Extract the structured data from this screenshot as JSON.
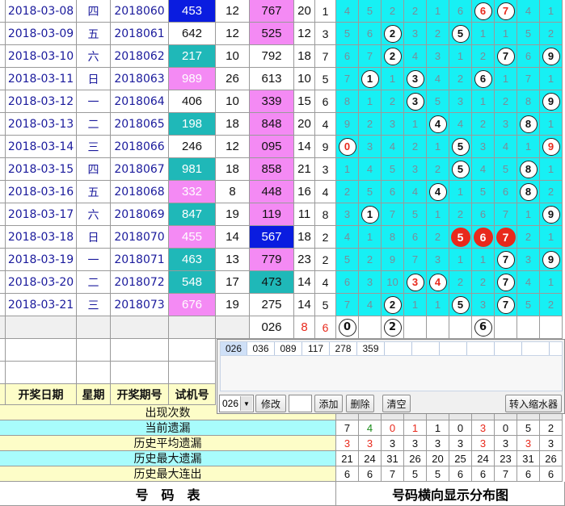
{
  "colors": {
    "teal": "#1fb8b8",
    "pink": "#f48af4",
    "blue": "#0a1ce0",
    "cyan": "#17f0f4",
    "yellow": "#fdfdc8",
    "red": "#e8291c"
  },
  "rows": [
    {
      "date": "2018-03-08",
      "week": "四",
      "period": "2018060",
      "trial": "453",
      "trial_color": "blue",
      "s1": "12",
      "num": "767",
      "num_color": "pink",
      "sum": "20",
      "span": "1",
      "marks": [
        [
          "d",
          "4"
        ],
        [
          "d",
          "5"
        ],
        [
          "d",
          "2"
        ],
        [
          "d",
          "2"
        ],
        [
          "d",
          "1"
        ],
        [
          "d",
          "6"
        ],
        [
          "wr",
          "6"
        ],
        [
          "wr",
          "7"
        ],
        [
          "d",
          "4"
        ],
        [
          "d",
          "1"
        ]
      ]
    },
    {
      "date": "2018-03-09",
      "week": "五",
      "period": "2018061",
      "trial": "642",
      "trial_color": "white",
      "s1": "12",
      "num": "525",
      "num_color": "pink",
      "sum": "12",
      "span": "3",
      "marks": [
        [
          "d",
          "5"
        ],
        [
          "d",
          "6"
        ],
        [
          "w",
          "2"
        ],
        [
          "d",
          "3"
        ],
        [
          "d",
          "2"
        ],
        [
          "w",
          "5"
        ],
        [
          "d",
          "1"
        ],
        [
          "d",
          "1"
        ],
        [
          "d",
          "5"
        ],
        [
          "d",
          "2"
        ]
      ]
    },
    {
      "date": "2018-03-10",
      "week": "六",
      "period": "2018062",
      "trial": "217",
      "trial_color": "teal",
      "s1": "10",
      "num": "792",
      "num_color": "white",
      "sum": "18",
      "span": "7",
      "marks": [
        [
          "d",
          "6"
        ],
        [
          "d",
          "7"
        ],
        [
          "w",
          "2"
        ],
        [
          "d",
          "4"
        ],
        [
          "d",
          "3"
        ],
        [
          "d",
          "1"
        ],
        [
          "d",
          "2"
        ],
        [
          "w",
          "7"
        ],
        [
          "d",
          "6"
        ],
        [
          "w",
          "9"
        ]
      ]
    },
    {
      "date": "2018-03-11",
      "week": "日",
      "period": "2018063",
      "trial": "989",
      "trial_color": "pink",
      "s1": "26",
      "num": "613",
      "num_color": "white",
      "sum": "10",
      "span": "5",
      "marks": [
        [
          "d",
          "7"
        ],
        [
          "w",
          "1"
        ],
        [
          "d",
          "1"
        ],
        [
          "w",
          "3"
        ],
        [
          "d",
          "4"
        ],
        [
          "d",
          "2"
        ],
        [
          "w",
          "6"
        ],
        [
          "d",
          "1"
        ],
        [
          "d",
          "7"
        ],
        [
          "d",
          "1"
        ]
      ]
    },
    {
      "date": "2018-03-12",
      "week": "一",
      "period": "2018064",
      "trial": "406",
      "trial_color": "white",
      "s1": "10",
      "num": "339",
      "num_color": "pink",
      "sum": "15",
      "span": "6",
      "marks": [
        [
          "d",
          "8"
        ],
        [
          "d",
          "1"
        ],
        [
          "d",
          "2"
        ],
        [
          "w",
          "3"
        ],
        [
          "d",
          "5"
        ],
        [
          "d",
          "3"
        ],
        [
          "d",
          "1"
        ],
        [
          "d",
          "2"
        ],
        [
          "d",
          "8"
        ],
        [
          "w",
          "9"
        ]
      ]
    },
    {
      "date": "2018-03-13",
      "week": "二",
      "period": "2018065",
      "trial": "198",
      "trial_color": "teal",
      "s1": "18",
      "num": "848",
      "num_color": "pink",
      "sum": "20",
      "span": "4",
      "marks": [
        [
          "d",
          "9"
        ],
        [
          "d",
          "2"
        ],
        [
          "d",
          "3"
        ],
        [
          "d",
          "1"
        ],
        [
          "w",
          "4"
        ],
        [
          "d",
          "4"
        ],
        [
          "d",
          "2"
        ],
        [
          "d",
          "3"
        ],
        [
          "w",
          "8"
        ],
        [
          "d",
          "1"
        ]
      ]
    },
    {
      "date": "2018-03-14",
      "week": "三",
      "period": "2018066",
      "trial": "246",
      "trial_color": "white",
      "s1": "12",
      "num": "095",
      "num_color": "pink",
      "sum": "14",
      "span": "9",
      "marks": [
        [
          "wr",
          "0"
        ],
        [
          "d",
          "3"
        ],
        [
          "d",
          "4"
        ],
        [
          "d",
          "2"
        ],
        [
          "d",
          "1"
        ],
        [
          "w",
          "5"
        ],
        [
          "d",
          "3"
        ],
        [
          "d",
          "4"
        ],
        [
          "d",
          "1"
        ],
        [
          "wr",
          "9"
        ]
      ]
    },
    {
      "date": "2018-03-15",
      "week": "四",
      "period": "2018067",
      "trial": "981",
      "trial_color": "teal",
      "s1": "18",
      "num": "858",
      "num_color": "pink",
      "sum": "21",
      "span": "3",
      "marks": [
        [
          "d",
          "1"
        ],
        [
          "d",
          "4"
        ],
        [
          "d",
          "5"
        ],
        [
          "d",
          "3"
        ],
        [
          "d",
          "2"
        ],
        [
          "w",
          "5"
        ],
        [
          "d",
          "4"
        ],
        [
          "d",
          "5"
        ],
        [
          "w",
          "8"
        ],
        [
          "d",
          "1"
        ]
      ]
    },
    {
      "date": "2018-03-16",
      "week": "五",
      "period": "2018068",
      "trial": "332",
      "trial_color": "pink",
      "s1": "8",
      "num": "448",
      "num_color": "pink",
      "sum": "16",
      "span": "4",
      "marks": [
        [
          "d",
          "2"
        ],
        [
          "d",
          "5"
        ],
        [
          "d",
          "6"
        ],
        [
          "d",
          "4"
        ],
        [
          "w",
          "4"
        ],
        [
          "d",
          "1"
        ],
        [
          "d",
          "5"
        ],
        [
          "d",
          "6"
        ],
        [
          "w",
          "8"
        ],
        [
          "d",
          "2"
        ]
      ]
    },
    {
      "date": "2018-03-17",
      "week": "六",
      "period": "2018069",
      "trial": "847",
      "trial_color": "teal",
      "s1": "19",
      "num": "119",
      "num_color": "pink",
      "sum": "11",
      "span": "8",
      "marks": [
        [
          "d",
          "3"
        ],
        [
          "w",
          "1"
        ],
        [
          "d",
          "7"
        ],
        [
          "d",
          "5"
        ],
        [
          "d",
          "1"
        ],
        [
          "d",
          "2"
        ],
        [
          "d",
          "6"
        ],
        [
          "d",
          "7"
        ],
        [
          "d",
          "1"
        ],
        [
          "w",
          "9"
        ]
      ]
    },
    {
      "date": "2018-03-18",
      "week": "日",
      "period": "2018070",
      "trial": "455",
      "trial_color": "pink",
      "s1": "14",
      "num": "567",
      "num_color": "blue",
      "sum": "18",
      "span": "2",
      "marks": [
        [
          "d",
          "4"
        ],
        [
          "d",
          "1"
        ],
        [
          "d",
          "8"
        ],
        [
          "d",
          "6"
        ],
        [
          "d",
          "2"
        ],
        [
          "r",
          "5"
        ],
        [
          "r",
          "6"
        ],
        [
          "r",
          "7"
        ],
        [
          "d",
          "2"
        ],
        [
          "d",
          "1"
        ]
      ]
    },
    {
      "date": "2018-03-19",
      "week": "一",
      "period": "2018071",
      "trial": "463",
      "trial_color": "teal",
      "s1": "13",
      "num": "779",
      "num_color": "pink",
      "sum": "23",
      "span": "2",
      "marks": [
        [
          "d",
          "5"
        ],
        [
          "d",
          "2"
        ],
        [
          "d",
          "9"
        ],
        [
          "d",
          "7"
        ],
        [
          "d",
          "3"
        ],
        [
          "d",
          "1"
        ],
        [
          "d",
          "1"
        ],
        [
          "w",
          "7"
        ],
        [
          "d",
          "3"
        ],
        [
          "w",
          "9"
        ]
      ]
    },
    {
      "date": "2018-03-20",
      "week": "二",
      "period": "2018072",
      "trial": "548",
      "trial_color": "teal",
      "s1": "17",
      "num": "473",
      "num_color": "teal",
      "sum": "14",
      "span": "4",
      "marks": [
        [
          "d",
          "6"
        ],
        [
          "d",
          "3"
        ],
        [
          "d",
          "10"
        ],
        [
          "wr",
          "3"
        ],
        [
          "wr",
          "4"
        ],
        [
          "d",
          "2"
        ],
        [
          "d",
          "2"
        ],
        [
          "w",
          "7"
        ],
        [
          "d",
          "4"
        ],
        [
          "d",
          "1"
        ]
      ]
    },
    {
      "date": "2018-03-21",
      "week": "三",
      "period": "2018073",
      "trial": "676",
      "trial_color": "pink",
      "s1": "19",
      "num": "275",
      "num_color": "white",
      "sum": "14",
      "span": "5",
      "marks": [
        [
          "d",
          "7"
        ],
        [
          "d",
          "4"
        ],
        [
          "w",
          "2"
        ],
        [
          "d",
          "1"
        ],
        [
          "d",
          "1"
        ],
        [
          "w",
          "5"
        ],
        [
          "d",
          "3"
        ],
        [
          "w",
          "7"
        ],
        [
          "d",
          "5"
        ],
        [
          "d",
          "2"
        ]
      ]
    }
  ],
  "forecast": {
    "num": "026",
    "sum": "8",
    "span": "6",
    "marks": [
      [
        "w",
        "0"
      ],
      [
        "e",
        ""
      ],
      [
        "w",
        "2"
      ],
      [
        "e",
        ""
      ],
      [
        "e",
        ""
      ],
      [
        "e",
        ""
      ],
      [
        "w",
        "6"
      ],
      [
        "e",
        ""
      ],
      [
        "e",
        ""
      ],
      [
        "e",
        ""
      ]
    ]
  },
  "headers": {
    "date": "开奖日期",
    "week": "星期",
    "period": "开奖期号",
    "trial": "试机号"
  },
  "stats": [
    {
      "label": "出现次数",
      "values": []
    },
    {
      "label": "当前遗漏",
      "values": [
        "7",
        "4",
        "0",
        "1",
        "1",
        "0",
        "3",
        "0",
        "5",
        "2"
      ]
    },
    {
      "label": "历史平均遗漏",
      "values": [
        "3",
        "3",
        "3",
        "3",
        "3",
        "3",
        "3",
        "3",
        "3",
        "3"
      ]
    },
    {
      "label": "历史最大遗漏",
      "values": [
        "21",
        "24",
        "31",
        "26",
        "20",
        "25",
        "24",
        "23",
        "31",
        "26"
      ]
    },
    {
      "label": "历史最大连出",
      "values": [
        "6",
        "6",
        "7",
        "5",
        "5",
        "6",
        "6",
        "7",
        "6",
        "6"
      ]
    }
  ],
  "footer": {
    "left": "号　码　表",
    "right": "号码横向显示分布图"
  },
  "dialog": {
    "tabs": [
      "026",
      "036",
      "089",
      "117",
      "278",
      "359"
    ],
    "select_value": "026",
    "buttons": {
      "modify": "修改",
      "add": "添加",
      "delete": "删除",
      "clear": "清空",
      "reducer": "转入缩水器"
    }
  }
}
